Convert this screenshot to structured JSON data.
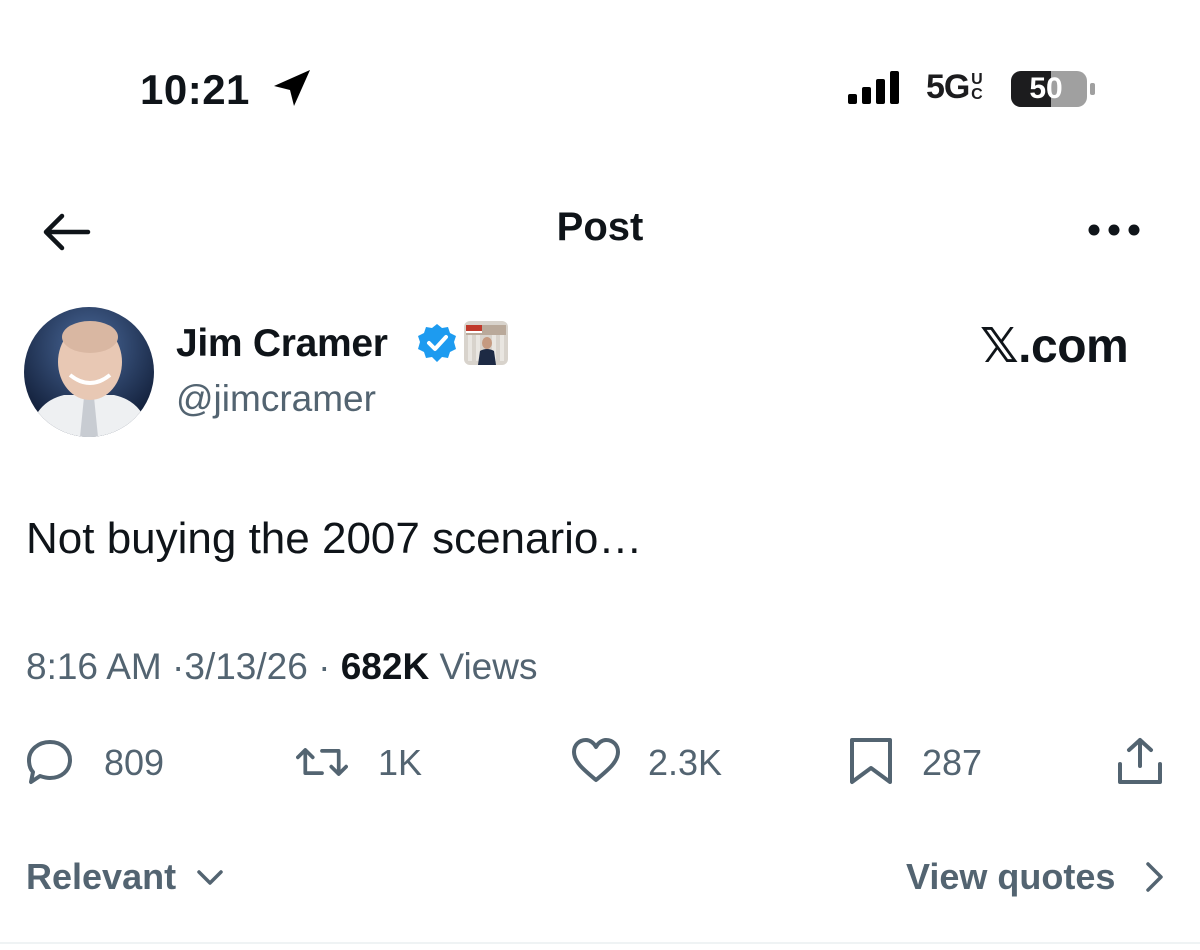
{
  "status_bar": {
    "time": "10:21",
    "network": "5G",
    "network_suffix": "UC",
    "battery": "50",
    "location_icon": "location-arrow-icon",
    "signal_icon": "cellular-signal-icon"
  },
  "header": {
    "title": "Post",
    "back_icon": "arrow-left-icon",
    "more_icon": "more-horizontal-icon"
  },
  "author": {
    "name": "Jim Cramer",
    "handle": "@jimcramer",
    "verified_color": "#1d9bf0"
  },
  "brand": {
    "label": "𝕏.com"
  },
  "post": {
    "text": "Not buying the 2007 scenario…",
    "time": "8:16 AM",
    "date": "3/13/26",
    "views_count": "682K",
    "views_label": "Views",
    "separator": "·"
  },
  "actions": {
    "replies": "809",
    "reposts": "1K",
    "likes": "2.3K",
    "bookmarks": "287"
  },
  "footer": {
    "sort_label": "Relevant",
    "quotes_label": "View quotes"
  },
  "colors": {
    "text_primary": "#0f1419",
    "text_secondary": "#536471",
    "accent": "#1d9bf0"
  }
}
